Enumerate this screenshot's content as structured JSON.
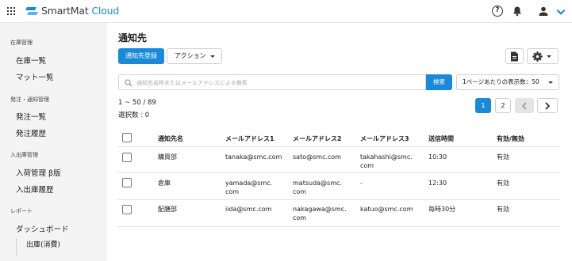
{
  "header": {
    "logo_text": "SmartMat",
    "logo_text_accent": "Cloud",
    "help_symbol": "?"
  },
  "colors": {
    "accent": "#1a8ad8",
    "sidebar_bg": "#f4f4f5"
  },
  "sidebar": {
    "sections": [
      {
        "label": "在庫管理",
        "items": [
          "在庫一覧",
          "マット一覧"
        ]
      },
      {
        "label": "発注・通知管理",
        "items": [
          "発注一覧",
          "発注履歴"
        ]
      },
      {
        "label": "入出庫管理",
        "items": [
          "入荷管理 β版",
          "入出庫履歴"
        ]
      },
      {
        "label": "レポート",
        "items": [
          "ダッシュボード",
          "出庫(消費)"
        ]
      }
    ]
  },
  "main": {
    "title": "通知先",
    "register_button": "通知先登録",
    "action_button": "アクション",
    "search": {
      "placeholder": "通知先名称またはメールアドレスによる検索",
      "button": "検索"
    },
    "per_page": "1ページあたりの表示数：50",
    "range_text": "1 ~ 50 / 89",
    "selected_text": "選択数 : 0",
    "pagination": {
      "pages": [
        "1",
        "2"
      ],
      "current": "1",
      "prev": "‹",
      "next": "›"
    }
  },
  "table": {
    "columns": [
      "通知先名",
      "メールアドレス1",
      "メールアドレス2",
      "メールアドレス3",
      "送信時間",
      "有効/無効"
    ],
    "rows": [
      {
        "name": "購買部",
        "email1": "tanaka@smc.com",
        "email2": "sato@smc.com",
        "email3": [
          "takahashi@smc.",
          "com"
        ],
        "time": "10:30",
        "status": "有効"
      },
      {
        "name": "倉庫",
        "email1": [
          "yamada@smc.",
          "com"
        ],
        "email2": [
          "matsuda@smc.",
          "com"
        ],
        "email3": [
          "-"
        ],
        "time": "12:30",
        "status": "有効"
      },
      {
        "name": "配膳部",
        "email1": "iida@smc.com",
        "email2": [
          "nakagawa@smc.",
          "com"
        ],
        "email3": [
          "katuo@smc.com"
        ],
        "time": "毎時30分",
        "status": "有効"
      }
    ]
  }
}
